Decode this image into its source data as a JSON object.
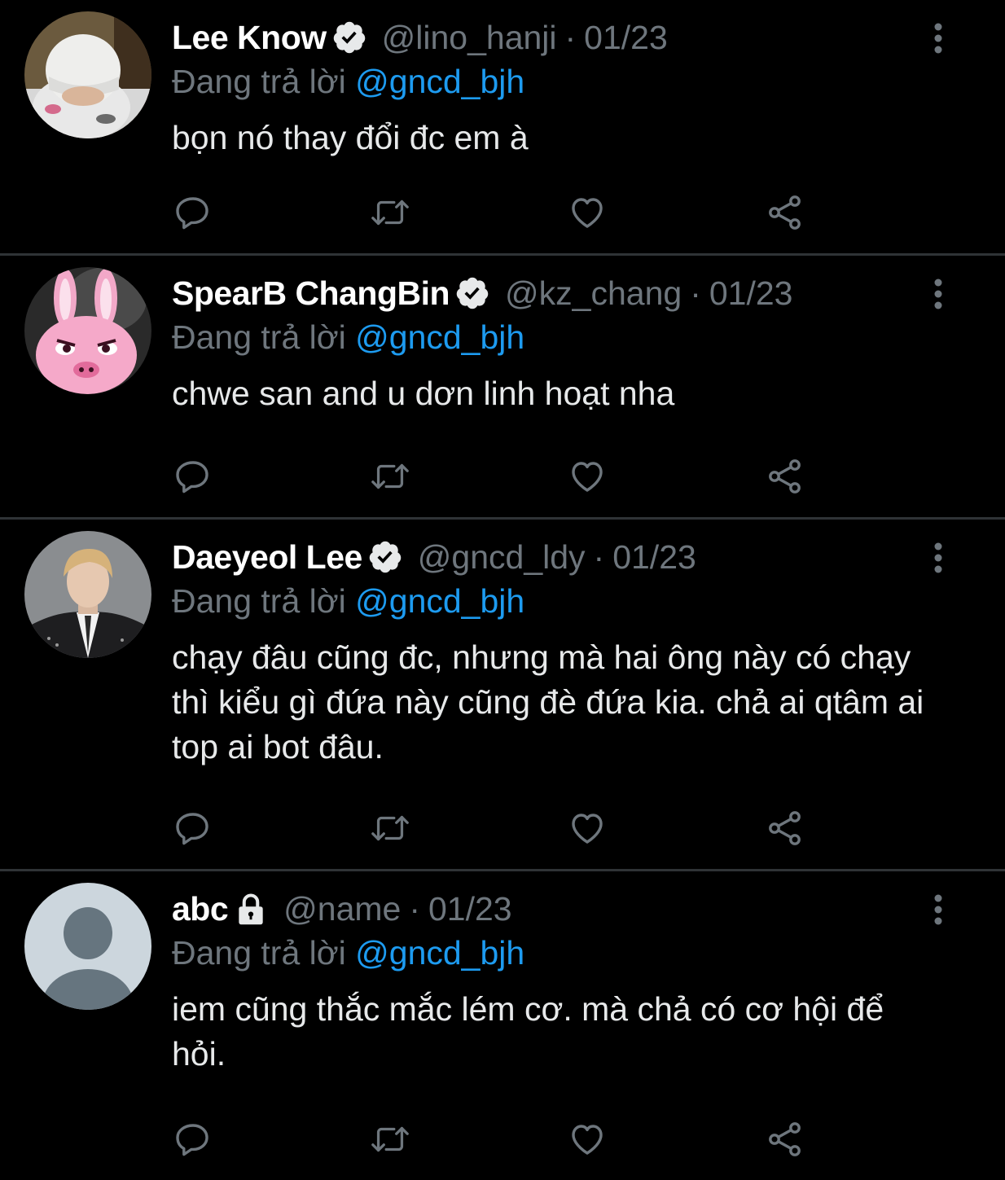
{
  "tweets": [
    {
      "name": "Lee Know",
      "verified": true,
      "handle": "@lino_hanji",
      "separator": "·",
      "date": "01/23",
      "reply_prefix": "Đang trả lời",
      "reply_to": "@gncd_bjh",
      "text": "bọn nó thay đổi đc em à",
      "avatar": "avatar-photo-white-beanie"
    },
    {
      "name": "SpearB ChangBin",
      "verified": true,
      "handle": "@kz_chang",
      "separator": "·",
      "date": "01/23",
      "reply_prefix": "Đang trả lời",
      "reply_to": "@gncd_bjh",
      "text": "chwe san and u dơn linh hoạt nha",
      "avatar": "avatar-photo-pink-pig-plush"
    },
    {
      "name": "Daeyeol Lee",
      "verified": true,
      "handle": "@gncd_ldy",
      "separator": "·",
      "date": "01/23",
      "reply_prefix": "Đang trả lời",
      "reply_to": "@gncd_bjh",
      "text": "chạy đâu cũng đc, nhưng mà hai ông này có chạy thì kiểu gì đứa này cũng đè đứa kia. chả ai qtâm ai top ai bot đâu.",
      "avatar": "avatar-photo-person-leather-jacket"
    },
    {
      "name": "abc",
      "verified": false,
      "locked": true,
      "handle": "@name",
      "separator": "·",
      "date": "01/23",
      "reply_prefix": "Đang trả lời",
      "reply_to": "@gncd_bjh",
      "text": "iem cũng thắc mắc lém cơ. mà chả có cơ hội để hỏi.",
      "avatar": "default-avatar"
    }
  ],
  "icons": {
    "reply": "reply-icon",
    "retweet": "retweet-icon",
    "like": "heart-icon",
    "share": "share-icon",
    "more": "more-vertical-icon",
    "verified": "verified-badge-icon",
    "lock": "lock-icon"
  },
  "colors": {
    "background": "#000000",
    "text": "#e7e9ea",
    "muted": "#6e767d",
    "link": "#1d9bf0",
    "divider": "#2f3336"
  }
}
